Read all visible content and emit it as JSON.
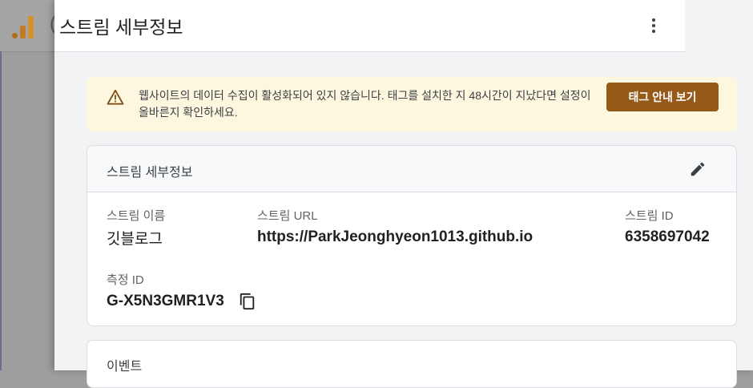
{
  "background": {
    "title_fragment": "(",
    "logo_icon": "analytics-logo-icon"
  },
  "panel": {
    "title": "스트림 세부정보",
    "more_icon": "more-vert-icon"
  },
  "banner": {
    "icon": "warning-icon",
    "text": "웹사이트의 데이터 수집이 활성화되어 있지 않습니다. 태그를 설치한 지 48시간이 지났다면 설정이 올바른지 확인하세요.",
    "button_label": "태그 안내 보기",
    "colors": {
      "background": "#fef7e0",
      "button": "#955a17"
    }
  },
  "details": {
    "title": "스트림 세부정보",
    "edit_icon": "pencil-icon",
    "stream_name_label": "스트림 이름",
    "stream_name": "깃블로그",
    "stream_url_label": "스트림 URL",
    "stream_url": "https://ParkJeonghyeon1013.github.io",
    "stream_id_label": "스트림 ID",
    "stream_id": "6358697042",
    "measurement_id_label": "측정 ID",
    "measurement_id": "G-X5N3GMR1V3",
    "copy_icon": "copy-icon"
  },
  "events": {
    "title": "이벤트"
  }
}
